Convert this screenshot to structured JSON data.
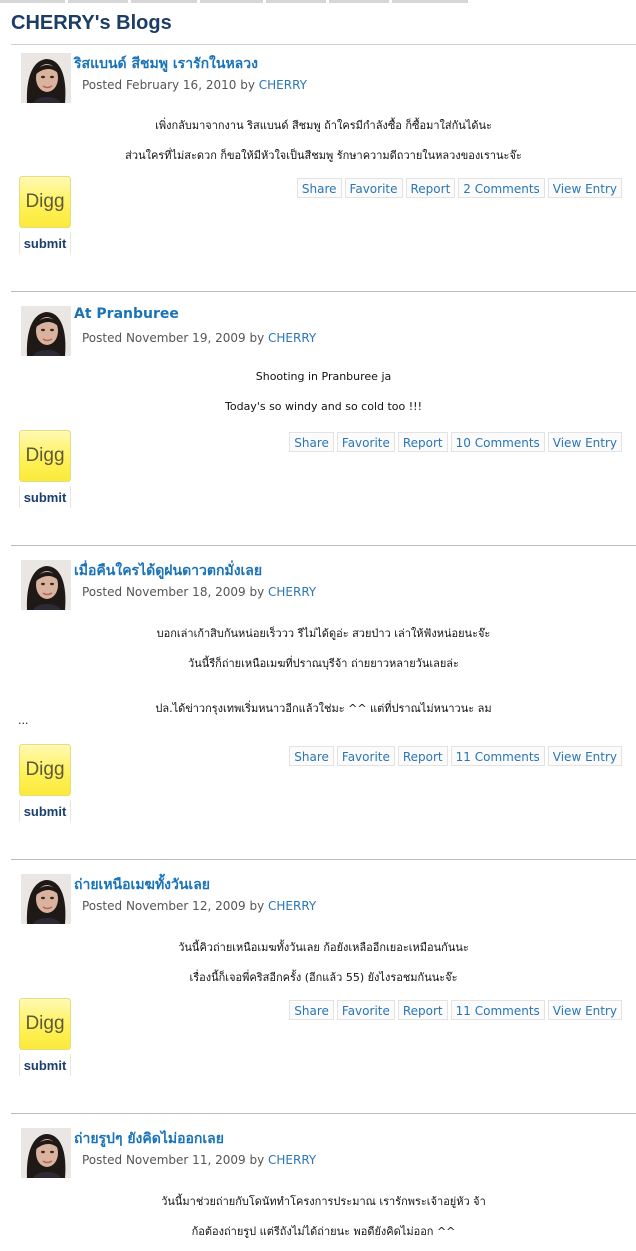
{
  "page": {
    "title": "CHERRY's Blogs"
  },
  "entries": [
    {
      "title": "ริสแบนด์ สีชมพู เรารักในหลวง",
      "date": "February 16, 2010",
      "author": "CHERRY",
      "body": [
        "เพิ่งกลับมาจากงาน ริสแบนด์ สีชมพู ถ้าใครมีกำลังซื้อ ก็ซื้อมาใส่กันได้นะ",
        "ส่วนใครที่ไม่สะดวก ก็ขอให้มีหัวใจเป็นสีชมพู รักษาความดีถวายในหลวงของเรานะจ๊ะ"
      ],
      "comments": "2 Comments"
    },
    {
      "title": "At Pranburee",
      "date": "November 19, 2009",
      "author": "CHERRY",
      "body": [
        "Shooting in Pranburee ja",
        "Today's so windy and so cold too !!!"
      ],
      "comments": "10 Comments"
    },
    {
      "title": "เมื่อคืนใครได้ดูฝนดาวตกมั่งเลย",
      "date": "November 18, 2009",
      "author": "CHERRY",
      "body": [
        "บอกเล่าเก้าสิบกันหน่อยเร็ววว รีไม่ได้ดูอ่ะ สวยป่าว เล่าให้ฟังหน่อยนะจ๊ะ",
        "วันนี้รีก็ถ่ายเหนือเมฆที่ปราณบุรีจ้า ถ่ายยาวหลายวันเลยล่ะ",
        "ปล.ได้ข่าวกรุงเทพเริ่มหนาวอีกแล้วใช่มะ ^^ แต่ที่ปราณไม่หนาวนะ ลม",
        "..."
      ],
      "comments": "11 Comments"
    },
    {
      "title": "ถ่ายเหนือเมฆทั้งวันเลย",
      "date": "November 12, 2009",
      "author": "CHERRY",
      "body": [
        "วันนี้คิวถ่ายเหนือเมฆทั้งวันเลย ก้อยังเหลืออีกเยอะเหมือนกันนะ",
        "เรื่องนี้ก็เจอพี่คริสอีกครั้ง (อีกแล้ว 55) ยังไงรอชมกันนะจ๊ะ"
      ],
      "comments": "11 Comments"
    },
    {
      "title": "ถ่ายรูปๆ ยังคิดไม่ออกเลย",
      "date": "November 11, 2009",
      "author": "CHERRY",
      "body": [
        "วันนี้มาช่วยถ่ายกับโดนัททำโครงการประมาณ เรารักพระเจ้าอยู่หัว จ้า",
        "ก้อต้องถ่ายรูป แต่รีถังไม่ได้ถ่ายนะ พอดียังคิดไม่ออก ^^"
      ]
    }
  ],
  "labels": {
    "posted_prefix": "Posted",
    "by": "by",
    "share": "Share",
    "favorite": "Favorite",
    "report": "Report",
    "view_entry": "View Entry",
    "digg": "Digg",
    "submit": "submit"
  },
  "colors": {
    "title": "#1b3d66",
    "link": "#1a73b8",
    "digg_yellow": "#fff25a"
  }
}
